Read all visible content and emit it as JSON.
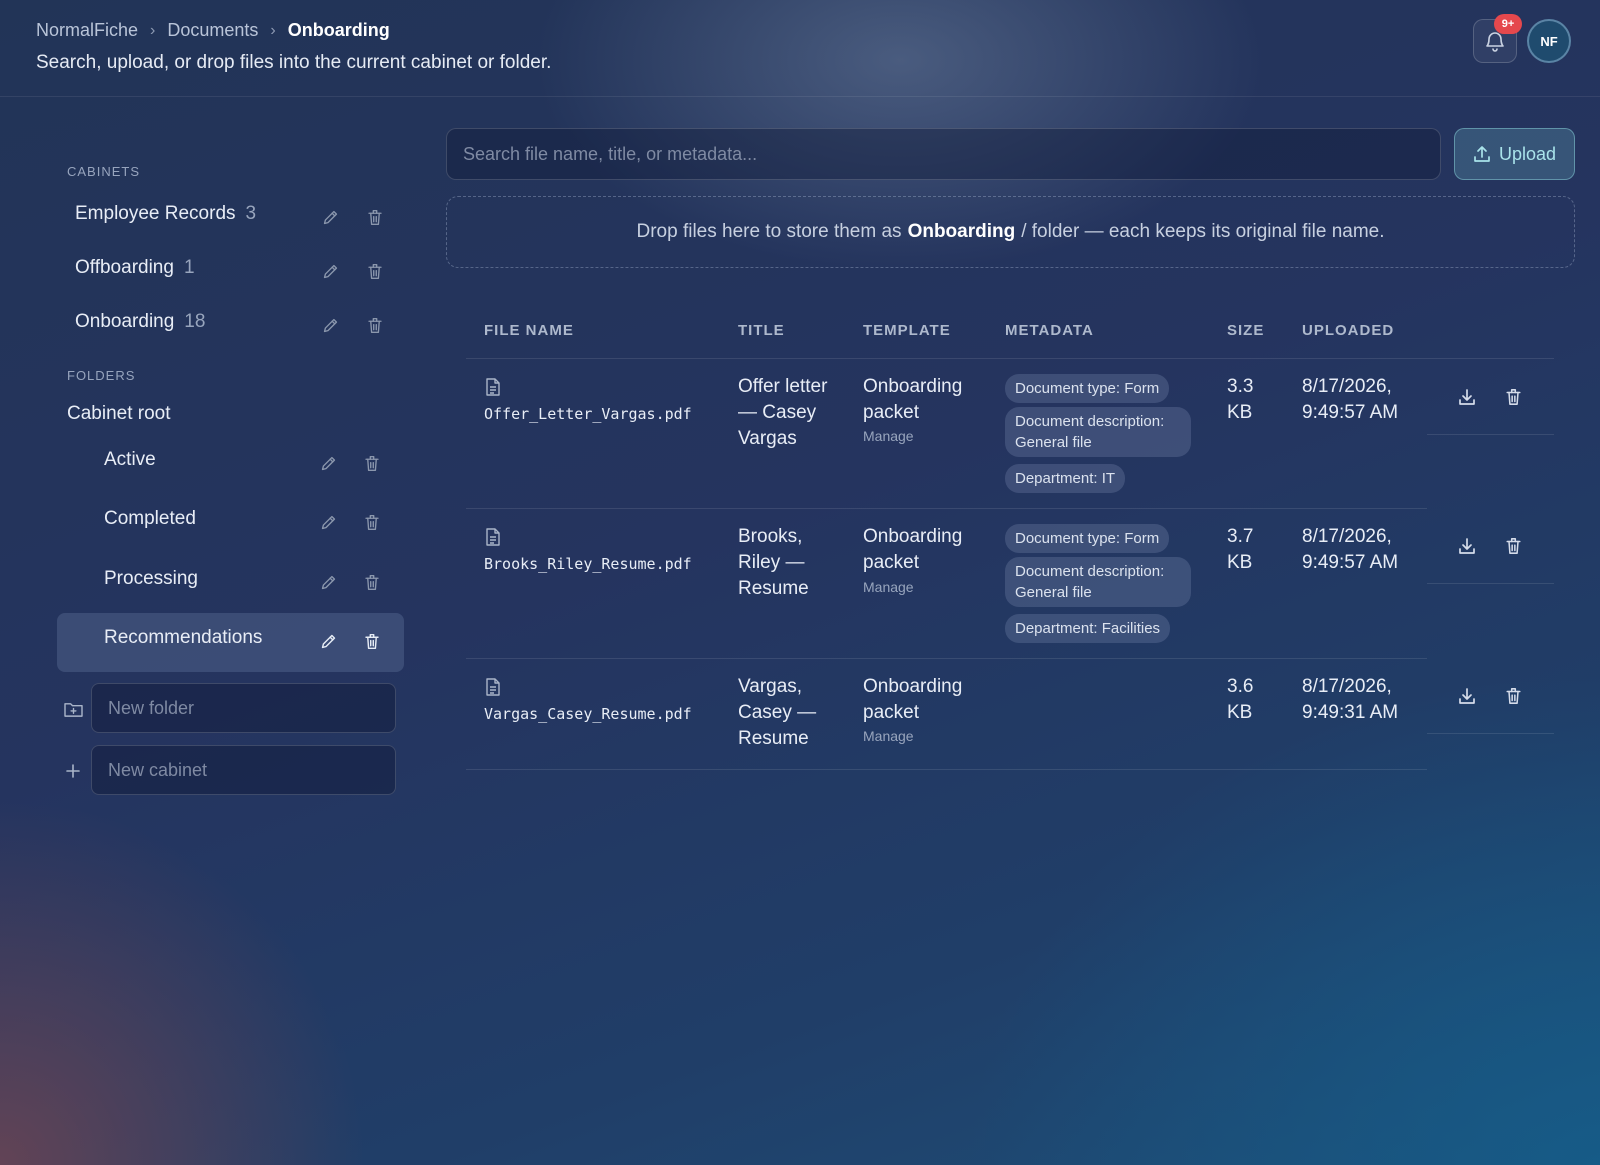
{
  "header": {
    "breadcrumb": [
      "NormalFiche",
      "Documents",
      "Onboarding"
    ],
    "subtitle": "Search, upload, or drop files into the current cabinet or folder.",
    "notifications_badge": "9+",
    "avatar_initials": "NF"
  },
  "sidebar": {
    "cabinets_label": "CABINETS",
    "cabinets": [
      {
        "label": "Employee Records",
        "count": "3"
      },
      {
        "label": "Offboarding",
        "count": "1"
      },
      {
        "label": "Onboarding",
        "count": "18"
      }
    ],
    "folders_label": "FOLDERS",
    "root_label": "Cabinet root",
    "folders": [
      {
        "label": "Active"
      },
      {
        "label": "Completed"
      },
      {
        "label": "Processing"
      },
      {
        "label": "Recommendations"
      }
    ],
    "active_folder": "Recommendations",
    "new_folder_placeholder": "New folder",
    "new_cabinet_placeholder": "New cabinet"
  },
  "search": {
    "placeholder": "Search file name, title, or metadata..."
  },
  "upload_label": "Upload",
  "dropzone": {
    "prefix": "Drop files here to store them as",
    "cabinet": "Onboarding",
    "suffix": "/ folder — each keeps its original file name."
  },
  "table": {
    "headers": [
      "FILE NAME",
      "TITLE",
      "TEMPLATE",
      "METADATA",
      "SIZE",
      "UPLOADED"
    ],
    "manage_label": "Manage",
    "rows": [
      {
        "file_name": "Offer_Letter_Vargas.pdf",
        "title": "Offer letter — Casey Vargas",
        "template": "Onboarding packet",
        "metadata": [
          "Document type: Form",
          "Document description: General file",
          "Department: IT"
        ],
        "size": "3.3 KB",
        "uploaded": "8/17/2026, 9:49:57 AM"
      },
      {
        "file_name": "Brooks_Riley_Resume.pdf",
        "title": "Brooks, Riley — Resume",
        "template": "Onboarding packet",
        "metadata": [
          "Document type: Form",
          "Document description: General file",
          "Department: Facilities"
        ],
        "size": "3.7 KB",
        "uploaded": "8/17/2026, 9:49:57 AM"
      },
      {
        "file_name": "Vargas_Casey_Resume.pdf",
        "title": "Vargas, Casey — Resume",
        "template": "Onboarding packet",
        "metadata": [],
        "size": "3.6 KB",
        "uploaded": "8/17/2026, 9:49:31 AM"
      }
    ]
  },
  "colors": {
    "accent": "#a9e3ea",
    "badge": "#e5484d"
  }
}
